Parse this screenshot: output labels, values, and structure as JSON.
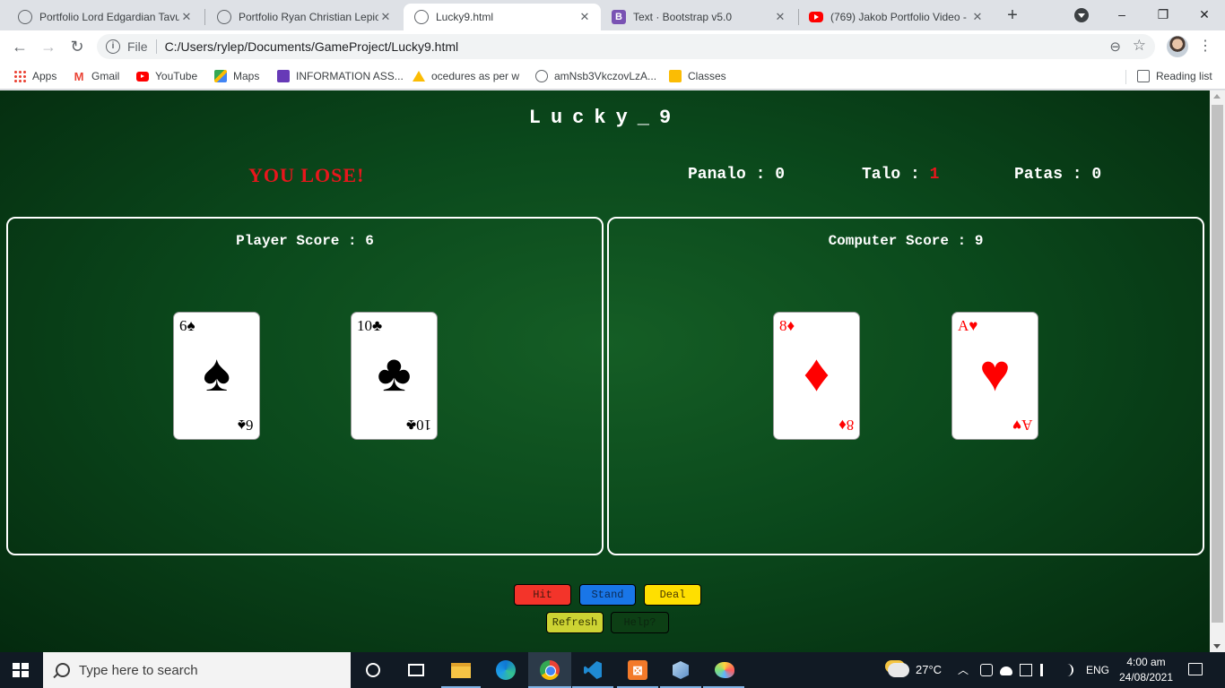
{
  "browser": {
    "tabs": [
      {
        "title": "Portfolio Lord Edgardian Tavu",
        "icon": "globe-icon"
      },
      {
        "title": "Portfolio Ryan Christian Lepio",
        "icon": "globe-icon"
      },
      {
        "title": "Lucky9.html",
        "icon": "globe-icon",
        "active": true
      },
      {
        "title": "Text · Bootstrap v5.0",
        "icon": "bootstrap-icon",
        "icon_glyph": "B"
      },
      {
        "title": "(769) Jakob Portfolio Video -",
        "icon": "youtube-icon"
      }
    ],
    "tab_close_glyph": "✕",
    "new_tab_glyph": "+",
    "window_controls": {
      "minimize": "–",
      "maximize": "❐",
      "close": "✕"
    },
    "nav": {
      "back": "←",
      "forward": "→",
      "reload": "↻"
    },
    "address": {
      "scheme_label": "File",
      "info_glyph": "i",
      "url": "C:/Users/rylep/Documents/GameProject/Lucky9.html",
      "zoom_glyph": "⊖",
      "star_glyph": "☆"
    },
    "menu_glyph": "⋮",
    "bookmarks": [
      {
        "label": "Apps",
        "icon": "apps-grid-icon"
      },
      {
        "label": "Gmail",
        "icon": "gmail-icon",
        "glyph": "M"
      },
      {
        "label": "YouTube",
        "icon": "youtube-icon"
      },
      {
        "label": "Maps",
        "icon": "maps-icon"
      },
      {
        "label": "INFORMATION ASS...",
        "icon": "forms-icon"
      },
      {
        "label": "ocedures as per w",
        "icon": "drive-icon"
      },
      {
        "label": "amNsb3VkczovLzA...",
        "icon": "globe-icon"
      },
      {
        "label": "Classes",
        "icon": "classroom-icon"
      }
    ],
    "reading_list": "Reading list"
  },
  "game": {
    "title": "Lucky_9",
    "result": "YOU LOSE!",
    "stats": {
      "panalo_label": "Panalo : ",
      "panalo": "0",
      "talo_label": "Talo : ",
      "talo": "1",
      "patas_label": "Patas : ",
      "patas": "0"
    },
    "player": {
      "score_label": "Player Score : ",
      "score": "6",
      "cards": [
        {
          "rank": "6",
          "suit": "♠",
          "color": "#000000"
        },
        {
          "rank": "10",
          "suit": "♣",
          "color": "#000000"
        }
      ]
    },
    "computer": {
      "score_label": "Computer Score : ",
      "score": "9",
      "cards": [
        {
          "rank": "8",
          "suit": "♦",
          "color": "#ff0000"
        },
        {
          "rank": "A",
          "suit": "♥",
          "color": "#ff0000"
        }
      ]
    },
    "buttons": {
      "hit": "Hit",
      "stand": "Stand",
      "deal": "Deal",
      "refresh": "Refresh",
      "help": "Help?"
    },
    "colors": {
      "table": "#0a4a1c",
      "lose_red": "#e8161c",
      "hit": "#f3342a",
      "stand": "#1976e8",
      "deal": "#ffdf00",
      "refresh": "#cdd333",
      "help": "#0d3f15"
    }
  },
  "taskbar": {
    "search_placeholder": "Type here to search",
    "apps": [
      "cortana-icon",
      "task-view-icon",
      "file-explorer-icon",
      "edge-icon",
      "chrome-icon",
      "vscode-icon",
      "xampp-icon",
      "virtualbox-icon",
      "paint-icon"
    ],
    "xampp_glyph": "⊠",
    "weather": "27°C",
    "tray_chevron": "︿",
    "language": "ENG",
    "time": "4:00 am",
    "date": "24/08/2021"
  }
}
